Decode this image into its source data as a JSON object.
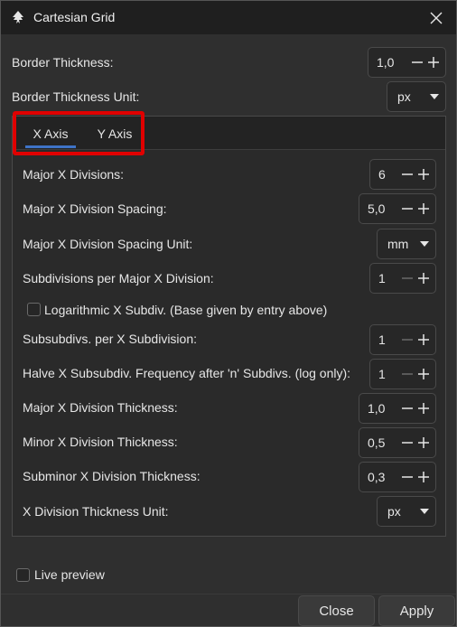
{
  "window": {
    "title": "Cartesian Grid",
    "icon": "inkscape-icon",
    "close_icon": "close-icon"
  },
  "top": {
    "border_thickness_label": "Border Thickness:",
    "border_thickness_value": "1,0",
    "border_unit_label": "Border Thickness Unit:",
    "border_unit_value": "px"
  },
  "tabs": [
    {
      "label": "X Axis",
      "active": true
    },
    {
      "label": "Y Axis",
      "active": false
    }
  ],
  "x_axis": {
    "major_divisions_label": "Major X Divisions:",
    "major_divisions_value": "6",
    "major_spacing_label": "Major X Division Spacing:",
    "major_spacing_value": "5,0",
    "spacing_unit_label": "Major X Division Spacing Unit:",
    "spacing_unit_value": "mm",
    "subdiv_label": "Subdivisions per Major X Division:",
    "subdiv_value": "1",
    "log_label": "Logarithmic X Subdiv. (Base given by entry above)",
    "log_checked": false,
    "subsubdiv_label": "Subsubdivs. per X Subdivision:",
    "subsubdiv_value": "1",
    "halve_label": "Halve X Subsubdiv. Frequency after 'n' Subdivs. (log only):",
    "halve_value": "1",
    "major_thickness_label": "Major X Division Thickness:",
    "major_thickness_value": "1,0",
    "minor_thickness_label": "Minor X Division Thickness:",
    "minor_thickness_value": "0,5",
    "subminor_thickness_label": "Subminor X Division Thickness:",
    "subminor_thickness_value": "0,3",
    "thickness_unit_label": "X Division Thickness Unit:",
    "thickness_unit_value": "px"
  },
  "footer": {
    "live_preview_label": "Live preview",
    "live_preview_checked": false,
    "close_label": "Close",
    "apply_label": "Apply"
  },
  "colors": {
    "tab_underline": "#3e73c7",
    "highlight": "#e00000"
  }
}
